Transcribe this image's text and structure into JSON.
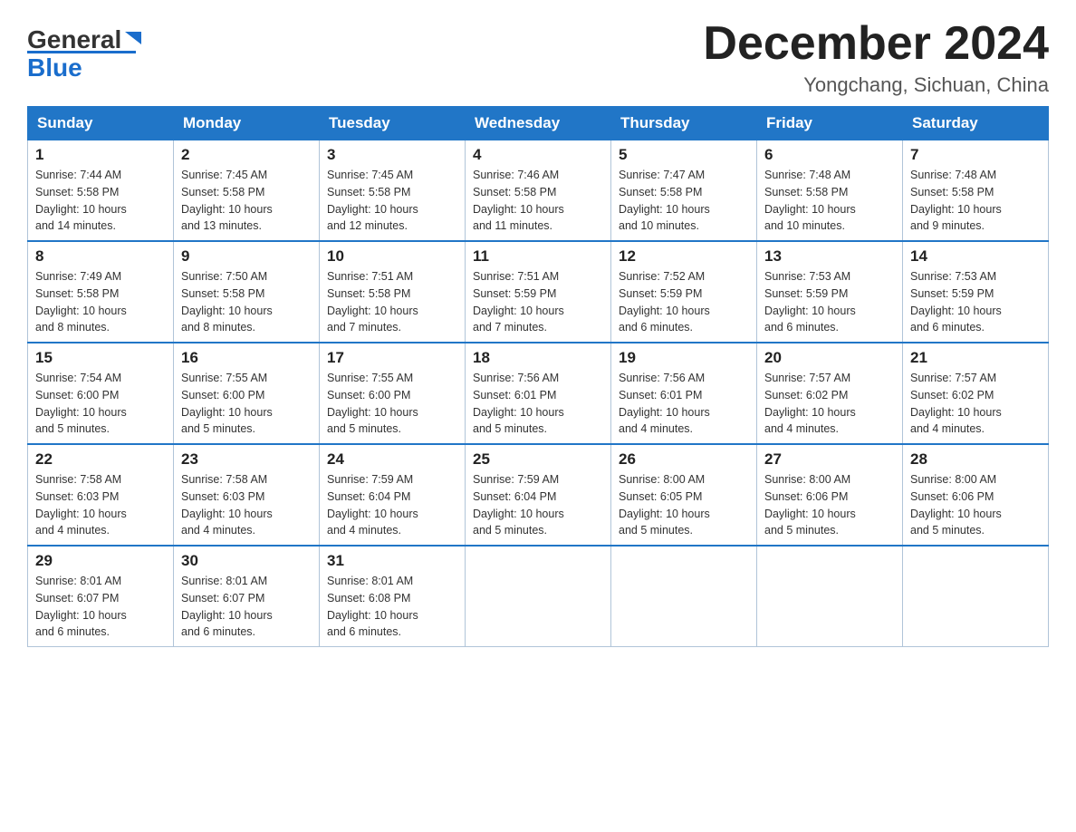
{
  "header": {
    "logo_general": "General",
    "logo_blue": "Blue",
    "month_title": "December 2024",
    "location": "Yongchang, Sichuan, China"
  },
  "weekdays": [
    "Sunday",
    "Monday",
    "Tuesday",
    "Wednesday",
    "Thursday",
    "Friday",
    "Saturday"
  ],
  "weeks": [
    [
      {
        "day": "1",
        "sunrise": "7:44 AM",
        "sunset": "5:58 PM",
        "daylight": "10 hours and 14 minutes."
      },
      {
        "day": "2",
        "sunrise": "7:45 AM",
        "sunset": "5:58 PM",
        "daylight": "10 hours and 13 minutes."
      },
      {
        "day": "3",
        "sunrise": "7:45 AM",
        "sunset": "5:58 PM",
        "daylight": "10 hours and 12 minutes."
      },
      {
        "day": "4",
        "sunrise": "7:46 AM",
        "sunset": "5:58 PM",
        "daylight": "10 hours and 11 minutes."
      },
      {
        "day": "5",
        "sunrise": "7:47 AM",
        "sunset": "5:58 PM",
        "daylight": "10 hours and 10 minutes."
      },
      {
        "day": "6",
        "sunrise": "7:48 AM",
        "sunset": "5:58 PM",
        "daylight": "10 hours and 10 minutes."
      },
      {
        "day": "7",
        "sunrise": "7:48 AM",
        "sunset": "5:58 PM",
        "daylight": "10 hours and 9 minutes."
      }
    ],
    [
      {
        "day": "8",
        "sunrise": "7:49 AM",
        "sunset": "5:58 PM",
        "daylight": "10 hours and 8 minutes."
      },
      {
        "day": "9",
        "sunrise": "7:50 AM",
        "sunset": "5:58 PM",
        "daylight": "10 hours and 8 minutes."
      },
      {
        "day": "10",
        "sunrise": "7:51 AM",
        "sunset": "5:58 PM",
        "daylight": "10 hours and 7 minutes."
      },
      {
        "day": "11",
        "sunrise": "7:51 AM",
        "sunset": "5:59 PM",
        "daylight": "10 hours and 7 minutes."
      },
      {
        "day": "12",
        "sunrise": "7:52 AM",
        "sunset": "5:59 PM",
        "daylight": "10 hours and 6 minutes."
      },
      {
        "day": "13",
        "sunrise": "7:53 AM",
        "sunset": "5:59 PM",
        "daylight": "10 hours and 6 minutes."
      },
      {
        "day": "14",
        "sunrise": "7:53 AM",
        "sunset": "5:59 PM",
        "daylight": "10 hours and 6 minutes."
      }
    ],
    [
      {
        "day": "15",
        "sunrise": "7:54 AM",
        "sunset": "6:00 PM",
        "daylight": "10 hours and 5 minutes."
      },
      {
        "day": "16",
        "sunrise": "7:55 AM",
        "sunset": "6:00 PM",
        "daylight": "10 hours and 5 minutes."
      },
      {
        "day": "17",
        "sunrise": "7:55 AM",
        "sunset": "6:00 PM",
        "daylight": "10 hours and 5 minutes."
      },
      {
        "day": "18",
        "sunrise": "7:56 AM",
        "sunset": "6:01 PM",
        "daylight": "10 hours and 5 minutes."
      },
      {
        "day": "19",
        "sunrise": "7:56 AM",
        "sunset": "6:01 PM",
        "daylight": "10 hours and 4 minutes."
      },
      {
        "day": "20",
        "sunrise": "7:57 AM",
        "sunset": "6:02 PM",
        "daylight": "10 hours and 4 minutes."
      },
      {
        "day": "21",
        "sunrise": "7:57 AM",
        "sunset": "6:02 PM",
        "daylight": "10 hours and 4 minutes."
      }
    ],
    [
      {
        "day": "22",
        "sunrise": "7:58 AM",
        "sunset": "6:03 PM",
        "daylight": "10 hours and 4 minutes."
      },
      {
        "day": "23",
        "sunrise": "7:58 AM",
        "sunset": "6:03 PM",
        "daylight": "10 hours and 4 minutes."
      },
      {
        "day": "24",
        "sunrise": "7:59 AM",
        "sunset": "6:04 PM",
        "daylight": "10 hours and 4 minutes."
      },
      {
        "day": "25",
        "sunrise": "7:59 AM",
        "sunset": "6:04 PM",
        "daylight": "10 hours and 5 minutes."
      },
      {
        "day": "26",
        "sunrise": "8:00 AM",
        "sunset": "6:05 PM",
        "daylight": "10 hours and 5 minutes."
      },
      {
        "day": "27",
        "sunrise": "8:00 AM",
        "sunset": "6:06 PM",
        "daylight": "10 hours and 5 minutes."
      },
      {
        "day": "28",
        "sunrise": "8:00 AM",
        "sunset": "6:06 PM",
        "daylight": "10 hours and 5 minutes."
      }
    ],
    [
      {
        "day": "29",
        "sunrise": "8:01 AM",
        "sunset": "6:07 PM",
        "daylight": "10 hours and 6 minutes."
      },
      {
        "day": "30",
        "sunrise": "8:01 AM",
        "sunset": "6:07 PM",
        "daylight": "10 hours and 6 minutes."
      },
      {
        "day": "31",
        "sunrise": "8:01 AM",
        "sunset": "6:08 PM",
        "daylight": "10 hours and 6 minutes."
      },
      null,
      null,
      null,
      null
    ]
  ],
  "labels": {
    "sunrise": "Sunrise:",
    "sunset": "Sunset:",
    "daylight": "Daylight:"
  }
}
